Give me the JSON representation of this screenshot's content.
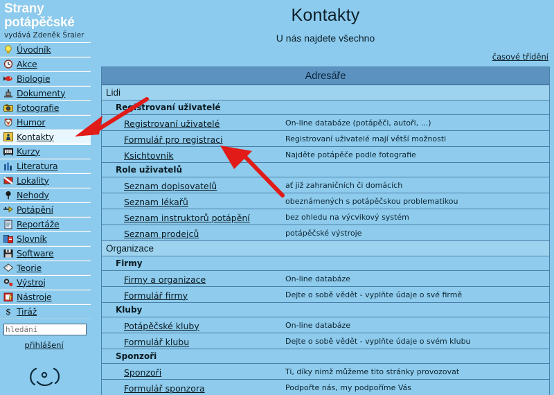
{
  "site": {
    "brand_line1": "Strany",
    "brand_line2": "potápěčské",
    "byline": "vydává Zdeněk Šraier"
  },
  "sidebar": {
    "items": [
      {
        "label": "Úvodník",
        "icon": "lightbulb-icon",
        "active": false
      },
      {
        "label": "Akce",
        "icon": "clock-icon",
        "active": false
      },
      {
        "label": "Biologie",
        "icon": "fish-icon",
        "active": false
      },
      {
        "label": "Dokumenty",
        "icon": "stamp-icon",
        "active": false
      },
      {
        "label": "Fotografie",
        "icon": "camera-icon",
        "active": false
      },
      {
        "label": "Humor",
        "icon": "clown-icon",
        "active": false
      },
      {
        "label": "Kontakty",
        "icon": "diver-icon",
        "active": true
      },
      {
        "label": "Kurzy",
        "icon": "projector-icon",
        "active": false
      },
      {
        "label": "Literatura",
        "icon": "books-icon",
        "active": false
      },
      {
        "label": "Lokality",
        "icon": "dive-flag-icon",
        "active": false
      },
      {
        "label": "Nehody",
        "icon": "pin-icon",
        "active": false
      },
      {
        "label": "Potápění",
        "icon": "diving-icon",
        "active": false
      },
      {
        "label": "Reportáže",
        "icon": "clipboard-icon",
        "active": false
      },
      {
        "label": "Slovník",
        "icon": "dictionary-icon",
        "active": false
      },
      {
        "label": "Software",
        "icon": "floppy-icon",
        "active": false
      },
      {
        "label": "Teorie",
        "icon": "diamond-icon",
        "active": false
      },
      {
        "label": "Výstroj",
        "icon": "gear-mask-icon",
        "active": false
      },
      {
        "label": "Nástroje",
        "icon": "notepad-icon",
        "active": false
      },
      {
        "label": "Tiráž",
        "icon": "dollar-icon",
        "active": false
      }
    ],
    "search_placeholder": "hledání",
    "search_value": "",
    "login_label": "přihlášení",
    "smiley": "( · )"
  },
  "main": {
    "title": "Kontakty",
    "subtitle": "U nás najdete všechno",
    "sort_link": "časové třídění",
    "table_header": "Adresáře",
    "rows": [
      {
        "level": 1,
        "name": "Lidi",
        "desc": ""
      },
      {
        "level": 2,
        "name": "Registrovaní uživatelé",
        "desc": ""
      },
      {
        "level": 3,
        "name": "Registrovaní uživatelé",
        "desc": "On-line databáze (potápěči, autoři, ...)"
      },
      {
        "level": 3,
        "name": "Formulář pro registraci",
        "desc": "Registrovaní uživatelé mají větší možnosti"
      },
      {
        "level": 3,
        "name": "Ksichtovník",
        "desc": "Najděte potápěče podle fotografie"
      },
      {
        "level": 2,
        "name": "Role uživatelů",
        "desc": ""
      },
      {
        "level": 3,
        "name": "Seznam dopisovatelů",
        "desc": "ať již zahraničních či domácích"
      },
      {
        "level": 3,
        "name": "Seznam lékařů",
        "desc": "obeznámených s potápěčskou problematikou"
      },
      {
        "level": 3,
        "name": "Seznam instruktorů potápění",
        "desc": "bez ohledu na výcvikový systém"
      },
      {
        "level": 3,
        "name": "Seznam prodejců",
        "desc": "potápěčské výstroje"
      },
      {
        "level": 1,
        "name": "Organizace",
        "desc": ""
      },
      {
        "level": 2,
        "name": "Firmy",
        "desc": ""
      },
      {
        "level": 3,
        "name": "Firmy a organizace",
        "desc": "On-line databáze"
      },
      {
        "level": 3,
        "name": "Formulář firmy",
        "desc": "Dejte o sobě vědět - vyplňte údaje o své firmě"
      },
      {
        "level": 2,
        "name": "Kluby",
        "desc": ""
      },
      {
        "level": 3,
        "name": "Potápěčské kluby",
        "desc": "On-line databáze"
      },
      {
        "level": 3,
        "name": "Formulář klubu",
        "desc": "Dejte o sobě vědět - vyplňte údaje o svém klubu"
      },
      {
        "level": 2,
        "name": "Sponzoři",
        "desc": ""
      },
      {
        "level": 3,
        "name": "Sponzoři",
        "desc": "Ti, díky nimž můžeme tito stránky provozovat"
      },
      {
        "level": 3,
        "name": "Formulář sponzora",
        "desc": "Podpořte nás, my podpoříme Vás"
      }
    ]
  },
  "annotations": {
    "arrow_color": "#e01b18",
    "arrow1_target": "Kontakty",
    "arrow2_target": "Formulář pro registraci"
  },
  "colors": {
    "page_bg": "#8ccbee",
    "table_header_bg": "#5b92c0",
    "section_bg": "#9ed3ef",
    "row_bg": "#8ecbec",
    "border": "#4a7fa8",
    "active_item_bg": "#e8f6fd"
  }
}
